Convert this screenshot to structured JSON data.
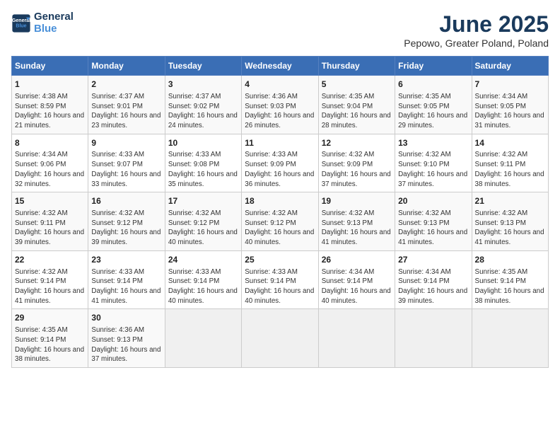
{
  "logo": {
    "line1": "General",
    "line2": "Blue"
  },
  "title": "June 2025",
  "location": "Pepowo, Greater Poland, Poland",
  "headers": [
    "Sunday",
    "Monday",
    "Tuesday",
    "Wednesday",
    "Thursday",
    "Friday",
    "Saturday"
  ],
  "weeks": [
    [
      {
        "day": "1",
        "sunrise": "4:38 AM",
        "sunset": "8:59 PM",
        "daylight": "16 hours and 21 minutes."
      },
      {
        "day": "2",
        "sunrise": "4:37 AM",
        "sunset": "9:01 PM",
        "daylight": "16 hours and 23 minutes."
      },
      {
        "day": "3",
        "sunrise": "4:37 AM",
        "sunset": "9:02 PM",
        "daylight": "16 hours and 24 minutes."
      },
      {
        "day": "4",
        "sunrise": "4:36 AM",
        "sunset": "9:03 PM",
        "daylight": "16 hours and 26 minutes."
      },
      {
        "day": "5",
        "sunrise": "4:35 AM",
        "sunset": "9:04 PM",
        "daylight": "16 hours and 28 minutes."
      },
      {
        "day": "6",
        "sunrise": "4:35 AM",
        "sunset": "9:05 PM",
        "daylight": "16 hours and 29 minutes."
      },
      {
        "day": "7",
        "sunrise": "4:34 AM",
        "sunset": "9:05 PM",
        "daylight": "16 hours and 31 minutes."
      }
    ],
    [
      {
        "day": "8",
        "sunrise": "4:34 AM",
        "sunset": "9:06 PM",
        "daylight": "16 hours and 32 minutes."
      },
      {
        "day": "9",
        "sunrise": "4:33 AM",
        "sunset": "9:07 PM",
        "daylight": "16 hours and 33 minutes."
      },
      {
        "day": "10",
        "sunrise": "4:33 AM",
        "sunset": "9:08 PM",
        "daylight": "16 hours and 35 minutes."
      },
      {
        "day": "11",
        "sunrise": "4:33 AM",
        "sunset": "9:09 PM",
        "daylight": "16 hours and 36 minutes."
      },
      {
        "day": "12",
        "sunrise": "4:32 AM",
        "sunset": "9:09 PM",
        "daylight": "16 hours and 37 minutes."
      },
      {
        "day": "13",
        "sunrise": "4:32 AM",
        "sunset": "9:10 PM",
        "daylight": "16 hours and 37 minutes."
      },
      {
        "day": "14",
        "sunrise": "4:32 AM",
        "sunset": "9:11 PM",
        "daylight": "16 hours and 38 minutes."
      }
    ],
    [
      {
        "day": "15",
        "sunrise": "4:32 AM",
        "sunset": "9:11 PM",
        "daylight": "16 hours and 39 minutes."
      },
      {
        "day": "16",
        "sunrise": "4:32 AM",
        "sunset": "9:12 PM",
        "daylight": "16 hours and 39 minutes."
      },
      {
        "day": "17",
        "sunrise": "4:32 AM",
        "sunset": "9:12 PM",
        "daylight": "16 hours and 40 minutes."
      },
      {
        "day": "18",
        "sunrise": "4:32 AM",
        "sunset": "9:12 PM",
        "daylight": "16 hours and 40 minutes."
      },
      {
        "day": "19",
        "sunrise": "4:32 AM",
        "sunset": "9:13 PM",
        "daylight": "16 hours and 41 minutes."
      },
      {
        "day": "20",
        "sunrise": "4:32 AM",
        "sunset": "9:13 PM",
        "daylight": "16 hours and 41 minutes."
      },
      {
        "day": "21",
        "sunrise": "4:32 AM",
        "sunset": "9:13 PM",
        "daylight": "16 hours and 41 minutes."
      }
    ],
    [
      {
        "day": "22",
        "sunrise": "4:32 AM",
        "sunset": "9:14 PM",
        "daylight": "16 hours and 41 minutes."
      },
      {
        "day": "23",
        "sunrise": "4:33 AM",
        "sunset": "9:14 PM",
        "daylight": "16 hours and 41 minutes."
      },
      {
        "day": "24",
        "sunrise": "4:33 AM",
        "sunset": "9:14 PM",
        "daylight": "16 hours and 40 minutes."
      },
      {
        "day": "25",
        "sunrise": "4:33 AM",
        "sunset": "9:14 PM",
        "daylight": "16 hours and 40 minutes."
      },
      {
        "day": "26",
        "sunrise": "4:34 AM",
        "sunset": "9:14 PM",
        "daylight": "16 hours and 40 minutes."
      },
      {
        "day": "27",
        "sunrise": "4:34 AM",
        "sunset": "9:14 PM",
        "daylight": "16 hours and 39 minutes."
      },
      {
        "day": "28",
        "sunrise": "4:35 AM",
        "sunset": "9:14 PM",
        "daylight": "16 hours and 38 minutes."
      }
    ],
    [
      {
        "day": "29",
        "sunrise": "4:35 AM",
        "sunset": "9:14 PM",
        "daylight": "16 hours and 38 minutes."
      },
      {
        "day": "30",
        "sunrise": "4:36 AM",
        "sunset": "9:13 PM",
        "daylight": "16 hours and 37 minutes."
      },
      null,
      null,
      null,
      null,
      null
    ]
  ],
  "labels": {
    "sunrise": "Sunrise:",
    "sunset": "Sunset:",
    "daylight": "Daylight hours"
  }
}
